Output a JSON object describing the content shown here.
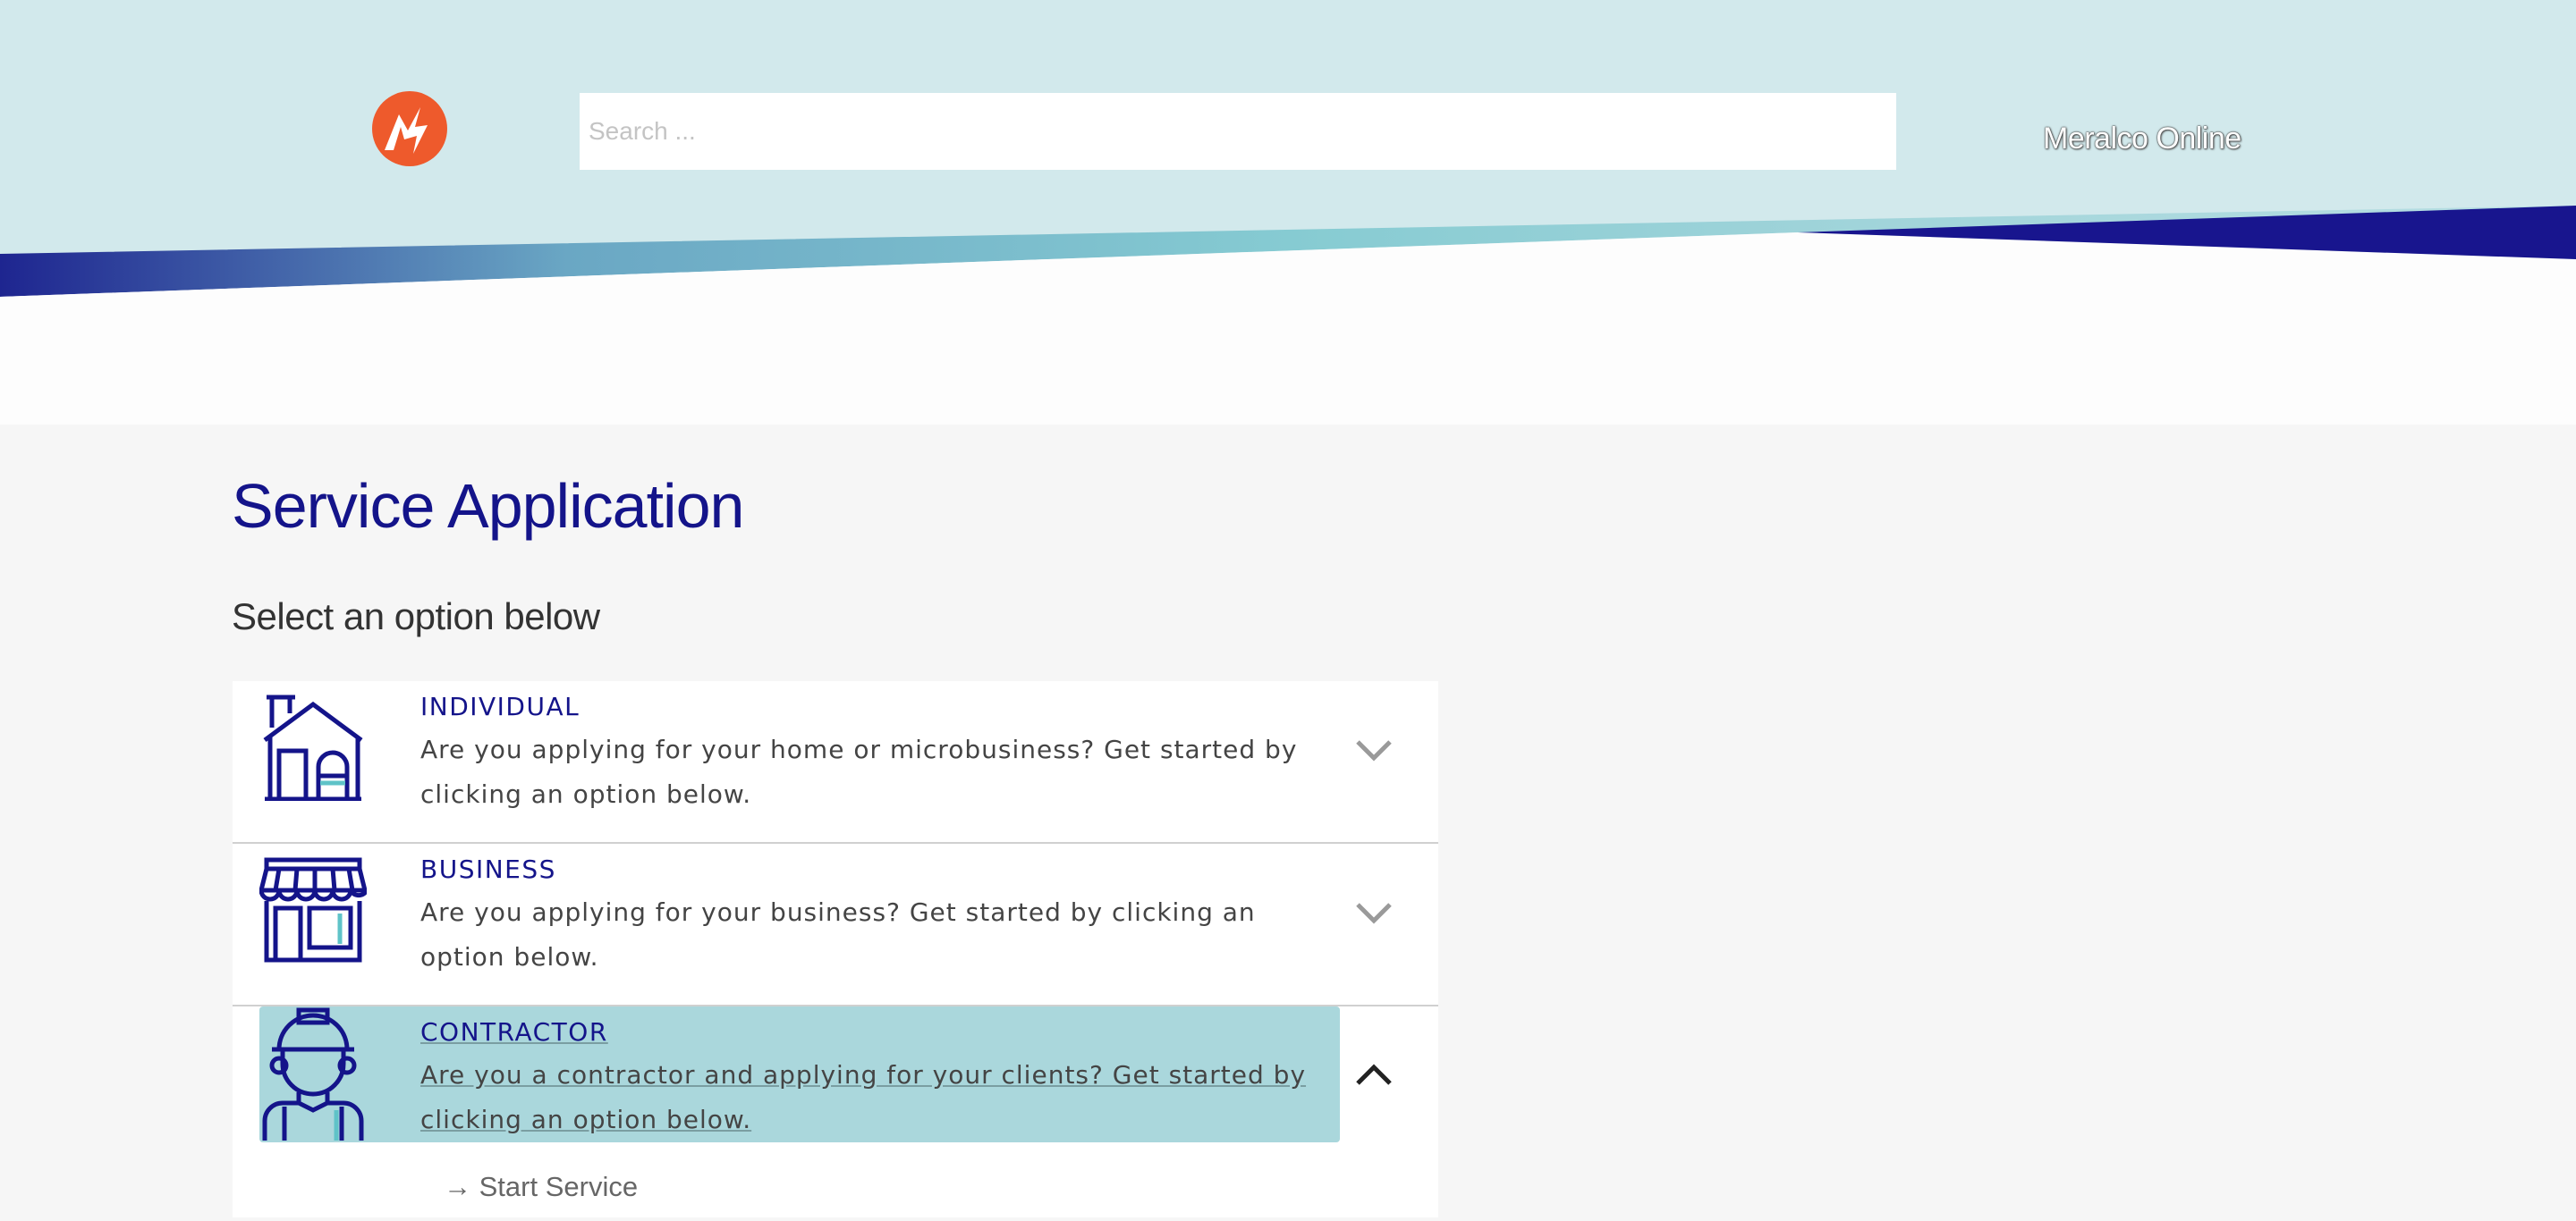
{
  "header": {
    "search_placeholder": "Search ...",
    "brand_link": "Meralco Online"
  },
  "page": {
    "title": "Service Application",
    "subtitle": "Select an option below"
  },
  "options": [
    {
      "title": "INDIVIDUAL",
      "description": "Are you applying for your home or microbusiness? Get started by clicking an option below.",
      "icon": "house-icon",
      "expanded": false
    },
    {
      "title": "BUSINESS",
      "description": "Are you applying for your business? Get started by clicking an option below.",
      "icon": "storefront-icon",
      "expanded": false
    },
    {
      "title": "CONTRACTOR",
      "description": "Are you a contractor and applying for your clients? Get started by clicking an option below.",
      "icon": "worker-icon",
      "expanded": true,
      "link_label": "Start Service"
    }
  ],
  "colors": {
    "header_bg": "#d2e9ec",
    "brand_navy": "#14148a",
    "logo_orange": "#ee5a2c",
    "highlight": "#aad7dc"
  }
}
